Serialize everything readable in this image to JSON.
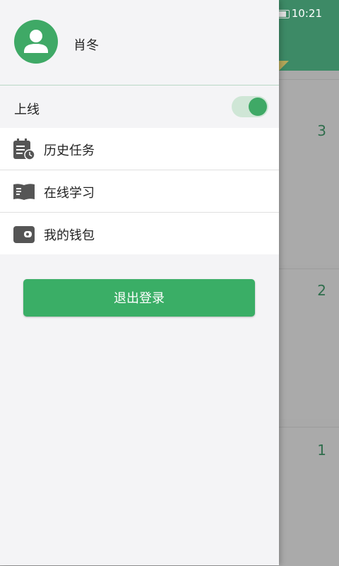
{
  "status_bar": {
    "time": "10:21"
  },
  "drawer": {
    "user": {
      "name": "肖冬"
    },
    "online": {
      "label": "上线",
      "enabled": true
    },
    "menu": [
      {
        "label": "历史任务",
        "icon": "history-task-icon"
      },
      {
        "label": "在线学习",
        "icon": "book-icon"
      },
      {
        "label": "我的钱包",
        "icon": "wallet-icon"
      }
    ],
    "logout_label": "退出登录"
  },
  "background": {
    "counts": [
      "3",
      "2",
      "1"
    ]
  },
  "colors": {
    "accent": "#3aae66",
    "toggle_track": "#cfe6d6",
    "drawer_bg": "#f4f4f6",
    "header_green": "#3d8a66"
  }
}
